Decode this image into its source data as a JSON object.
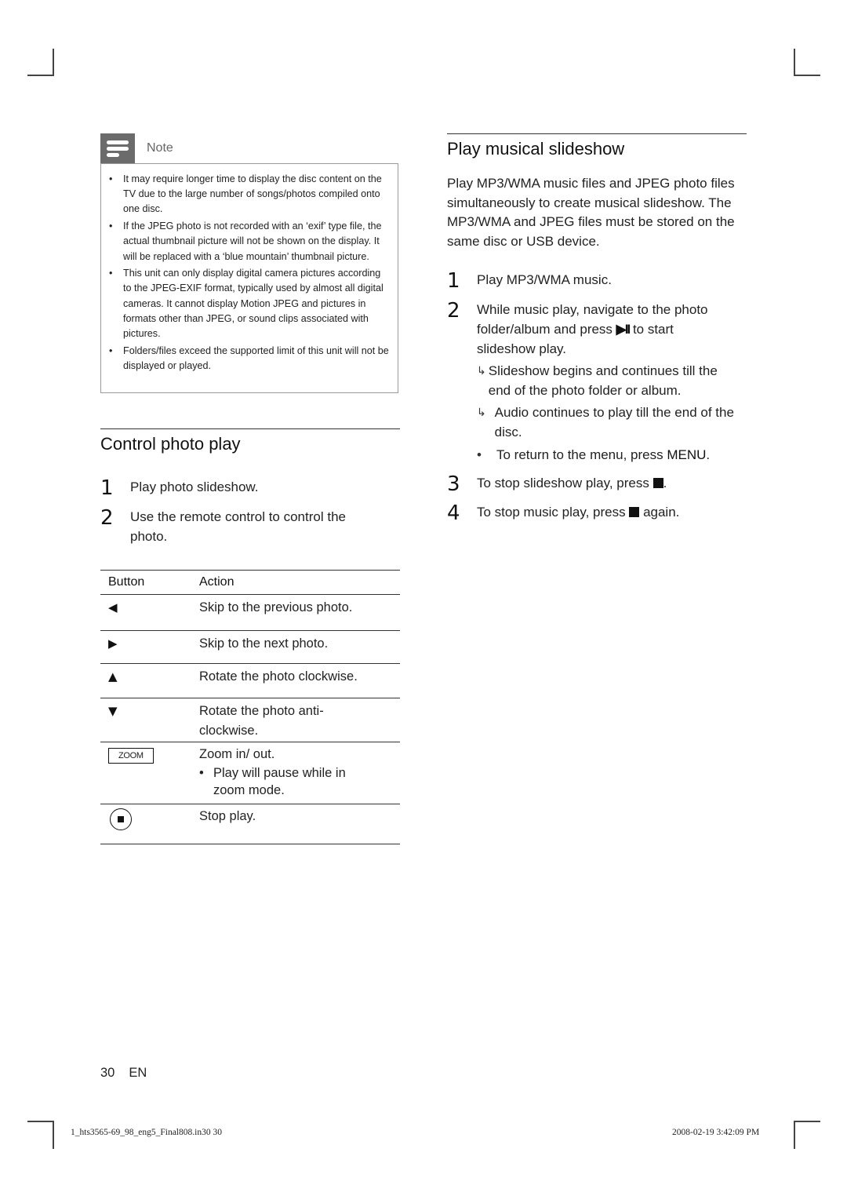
{
  "note": {
    "title": "Note",
    "items": [
      "It may require longer time to display the disc content on the TV due to the large number of songs/photos compiled onto one disc.",
      "If the JPEG photo is not recorded with an ‘exif’ type file, the actual thumbnail picture will not be shown on the display.  It will be replaced with a ‘blue mountain’ thumbnail picture.",
      "This unit can only display digital camera pictures according to the JPEG-EXIF format, typically used by almost all digital cameras.  It cannot display Motion JPEG and pictures in formats other than JPEG, or sound clips associated with pictures.",
      "Folders/files exceed the supported limit of this unit will not be displayed or played."
    ]
  },
  "control_photo": {
    "title": "Control photo play",
    "steps": [
      {
        "num": "1",
        "text": "Play photo slideshow."
      },
      {
        "num": "2",
        "text": "Use the remote control to control the photo."
      }
    ],
    "table": {
      "headers": [
        "Button",
        "Action"
      ],
      "rows": [
        {
          "button_icon": "left-triangle-icon",
          "button_glyph": "◀",
          "action": "Skip to the previous photo."
        },
        {
          "button_icon": "right-triangle-icon",
          "button_glyph": "▶",
          "action": "Skip to the next photo."
        },
        {
          "button_icon": "up-triangle-icon",
          "button_glyph": "▲",
          "action": "Rotate the photo clockwise."
        },
        {
          "button_icon": "down-triangle-icon",
          "button_glyph": "▼",
          "action": "Rotate the photo anti- clockwise."
        },
        {
          "button_icon": "zoom-key-icon",
          "button_label": "ZOOM",
          "action": "Zoom in/ out.",
          "note": "Play will pause while in zoom mode."
        },
        {
          "button_icon": "stop-circle-icon",
          "action": "Stop play."
        }
      ]
    }
  },
  "musical_slideshow": {
    "title": "Play musical slideshow",
    "intro": "Play MP3/WMA music files and JPEG photo files simultaneously to create musical slideshow. The MP3/WMA and JPEG files must be stored on the same disc or USB device.",
    "steps": [
      {
        "num": "1",
        "text": "Play MP3/WMA music."
      },
      {
        "num": "2",
        "text_before": "While music play, navigate to the photo folder/album and press",
        "key_glyph": "▶II",
        "text_after": "to start slideshow play."
      },
      {
        "num": "3",
        "text_before": "To stop slideshow play, press",
        "text_after": "."
      },
      {
        "num": "4",
        "text_before": "To stop music play, press",
        "text_after": "again."
      }
    ],
    "results": [
      "Slideshow begins and continues till the end of the photo folder or album.",
      "Audio continues to play till the end of the disc."
    ],
    "bullet": {
      "text_before": "To return to the menu, press",
      "key": "MENU",
      "text_after": "."
    },
    "result_arrow_glyph": "↳"
  },
  "footer": {
    "page_number": "30",
    "language": "EN",
    "slug_left": "1_hts3565-69_98_eng5_Final808.in30   30",
    "slug_right": "2008-02-19   3:42:09 PM"
  }
}
